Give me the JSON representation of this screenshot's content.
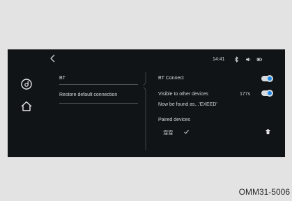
{
  "topbar": {
    "time": "14:41",
    "status_icons": [
      "bluetooth-icon",
      "volume-icon",
      "battery-icon"
    ]
  },
  "left_rail": {
    "buttons": [
      "music-disc-icon",
      "home-icon"
    ]
  },
  "menu": {
    "items": [
      {
        "label": "BT"
      },
      {
        "label": "Restore default connection"
      }
    ]
  },
  "bt": {
    "connect_label": "BT Connect",
    "connect_on": true,
    "visible_label": "Visible to other devices",
    "visible_timer": "177s",
    "visible_on": true,
    "found_as": "Now be found as...'EXEED'",
    "paired_label": "Paired devices",
    "paired_device_name": "溜溜"
  },
  "caption": "OMM31-5006",
  "colors": {
    "screen_bg": "#111417",
    "accent": "#1e88e5",
    "page_bg": "#e3e3e3"
  }
}
